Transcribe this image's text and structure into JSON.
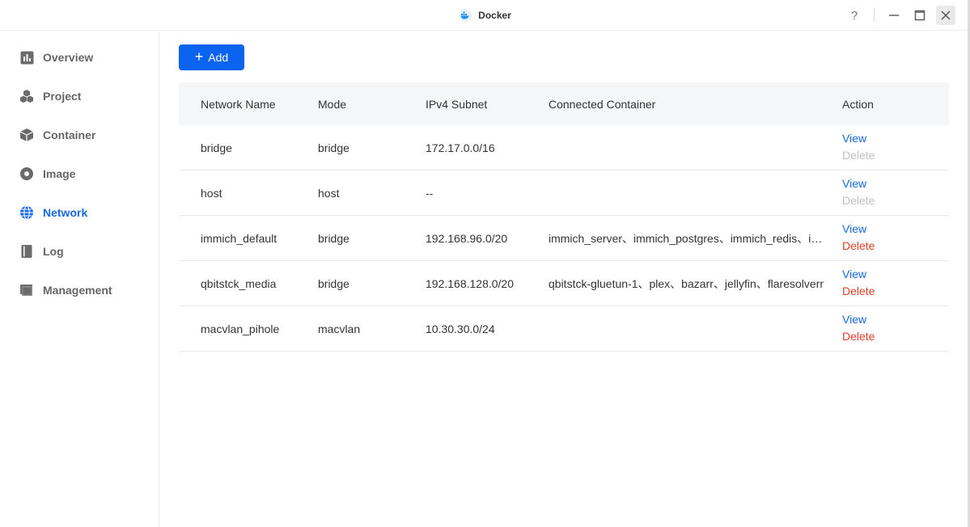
{
  "window": {
    "title": "Docker",
    "help_label": "?"
  },
  "sidebar": {
    "items": [
      {
        "label": "Overview",
        "icon": "bar-chart-icon"
      },
      {
        "label": "Project",
        "icon": "cubes-icon"
      },
      {
        "label": "Container",
        "icon": "box-icon"
      },
      {
        "label": "Image",
        "icon": "disc-icon"
      },
      {
        "label": "Network",
        "icon": "globe-icon",
        "active": true
      },
      {
        "label": "Log",
        "icon": "book-icon"
      },
      {
        "label": "Management",
        "icon": "drive-icon"
      }
    ]
  },
  "toolbar": {
    "add_label": "Add",
    "add_icon": "+"
  },
  "table": {
    "headers": {
      "name": "Network Name",
      "mode": "Mode",
      "subnet": "IPv4 Subnet",
      "connected": "Connected Container",
      "action": "Action"
    },
    "rows": [
      {
        "name": "bridge",
        "mode": "bridge",
        "subnet": "172.17.0.0/16",
        "connected": "",
        "view": "View",
        "delete": "Delete",
        "delete_disabled": true
      },
      {
        "name": "host",
        "mode": "host",
        "subnet": "--",
        "connected": "",
        "view": "View",
        "delete": "Delete",
        "delete_disabled": true
      },
      {
        "name": "immich_default",
        "mode": "bridge",
        "subnet": "192.168.96.0/20",
        "connected": "immich_server、immich_postgres、immich_redis、immich_machine_learning",
        "view": "View",
        "delete": "Delete",
        "delete_disabled": false
      },
      {
        "name": "qbitstck_media",
        "mode": "bridge",
        "subnet": "192.168.128.0/20",
        "connected": "qbitstck-gluetun-1、plex、bazarr、jellyfin、flaresolverr",
        "view": "View",
        "delete": "Delete",
        "delete_disabled": false
      },
      {
        "name": "macvlan_pihole",
        "mode": "macvlan",
        "subnet": "10.30.30.0/24",
        "connected": "",
        "view": "View",
        "delete": "Delete",
        "delete_disabled": false
      }
    ]
  },
  "colors": {
    "accent": "#1668e3",
    "button": "#0a64f0",
    "danger": "#e0402a",
    "disabled": "#c0c0c0"
  }
}
